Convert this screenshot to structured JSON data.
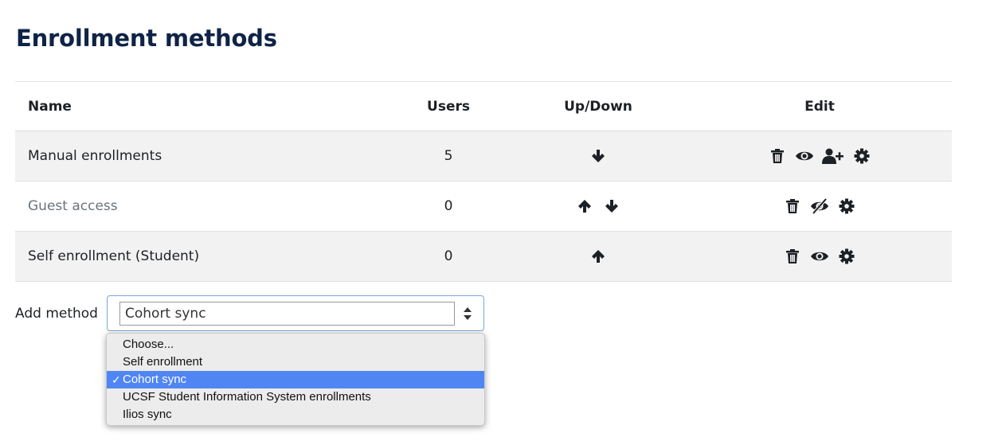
{
  "page": {
    "title": "Enrollment methods"
  },
  "table": {
    "headers": {
      "name": "Name",
      "users": "Users",
      "updown": "Up/Down",
      "edit": "Edit"
    },
    "rows": [
      {
        "name": "Manual enrollments",
        "users": "5",
        "updown_icons": [
          "arrow-down-icon"
        ],
        "edit_icons": [
          "trash-icon",
          "eye-icon",
          "user-plus-icon",
          "gear-icon"
        ],
        "disabled": false
      },
      {
        "name": "Guest access",
        "users": "0",
        "updown_icons": [
          "arrow-up-icon",
          "arrow-down-icon"
        ],
        "edit_icons": [
          "trash-icon",
          "eye-slash-icon",
          "gear-icon"
        ],
        "disabled": true
      },
      {
        "name": "Self enrollment (Student)",
        "users": "0",
        "updown_icons": [
          "arrow-up-icon"
        ],
        "edit_icons": [
          "trash-icon",
          "eye-icon",
          "gear-icon"
        ],
        "disabled": false
      }
    ]
  },
  "add_method": {
    "label": "Add method",
    "selected": "Cohort sync",
    "options": [
      {
        "label": "Choose...",
        "selected": false
      },
      {
        "label": "Self enrollment",
        "selected": false
      },
      {
        "label": "Cohort sync",
        "selected": true
      },
      {
        "label": "UCSF Student Information System enrollments",
        "selected": false
      },
      {
        "label": "Ilios sync",
        "selected": false
      }
    ],
    "check_mark": "✓"
  },
  "colors": {
    "title": "#0f2346",
    "row_shade": "#f2f2f2",
    "muted_text": "#6a737b",
    "selected_option": "#4f86f4",
    "icon": "#1d2125"
  }
}
